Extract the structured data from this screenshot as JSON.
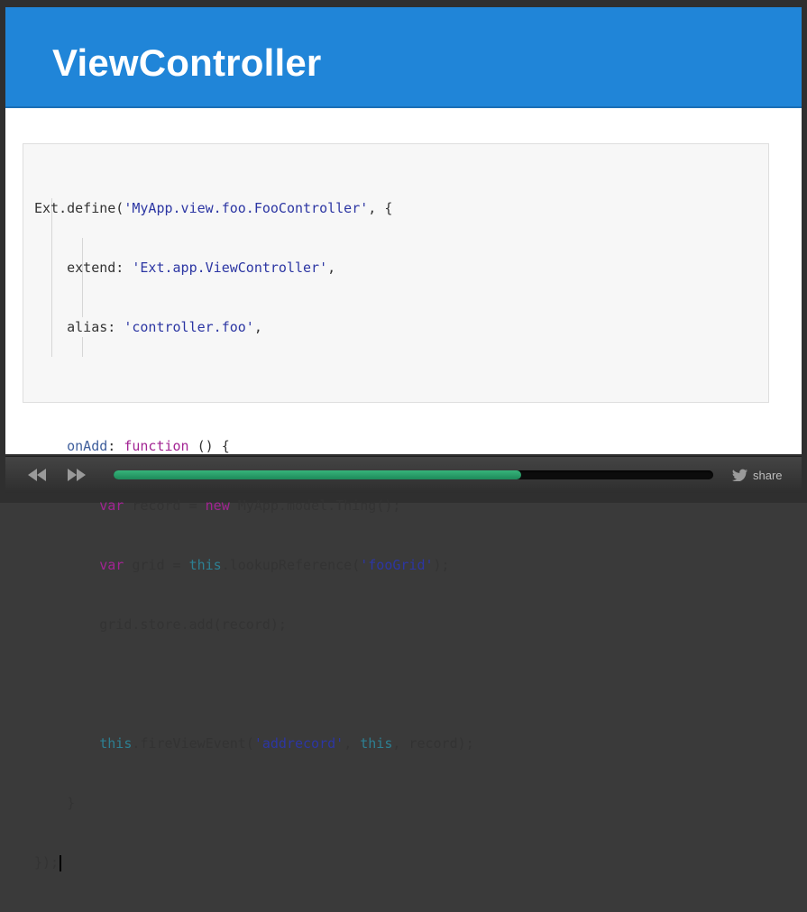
{
  "slide": {
    "title": "ViewController",
    "code_lines": [
      "Ext.define('MyApp.view.foo.FooController', {",
      "    extend: 'Ext.app.ViewController',",
      "    alias: 'controller.foo',",
      "",
      "    onAdd: function () {",
      "        var record = new MyApp.model.Thing();",
      "        var grid = this.lookupReference('fooGrid');",
      "        grid.store.add(record);",
      "",
      "        this.fireViewEvent('addrecord', this, record);",
      "    }",
      "});"
    ]
  },
  "player": {
    "rewind_icon": "rewind-icon",
    "forward_icon": "fast-forward-icon",
    "progress": 0.68,
    "share_label": "share",
    "share_icon": "twitter-bird-icon"
  },
  "colors": {
    "header": "#2085d8",
    "progress": "#2a9e6a"
  }
}
